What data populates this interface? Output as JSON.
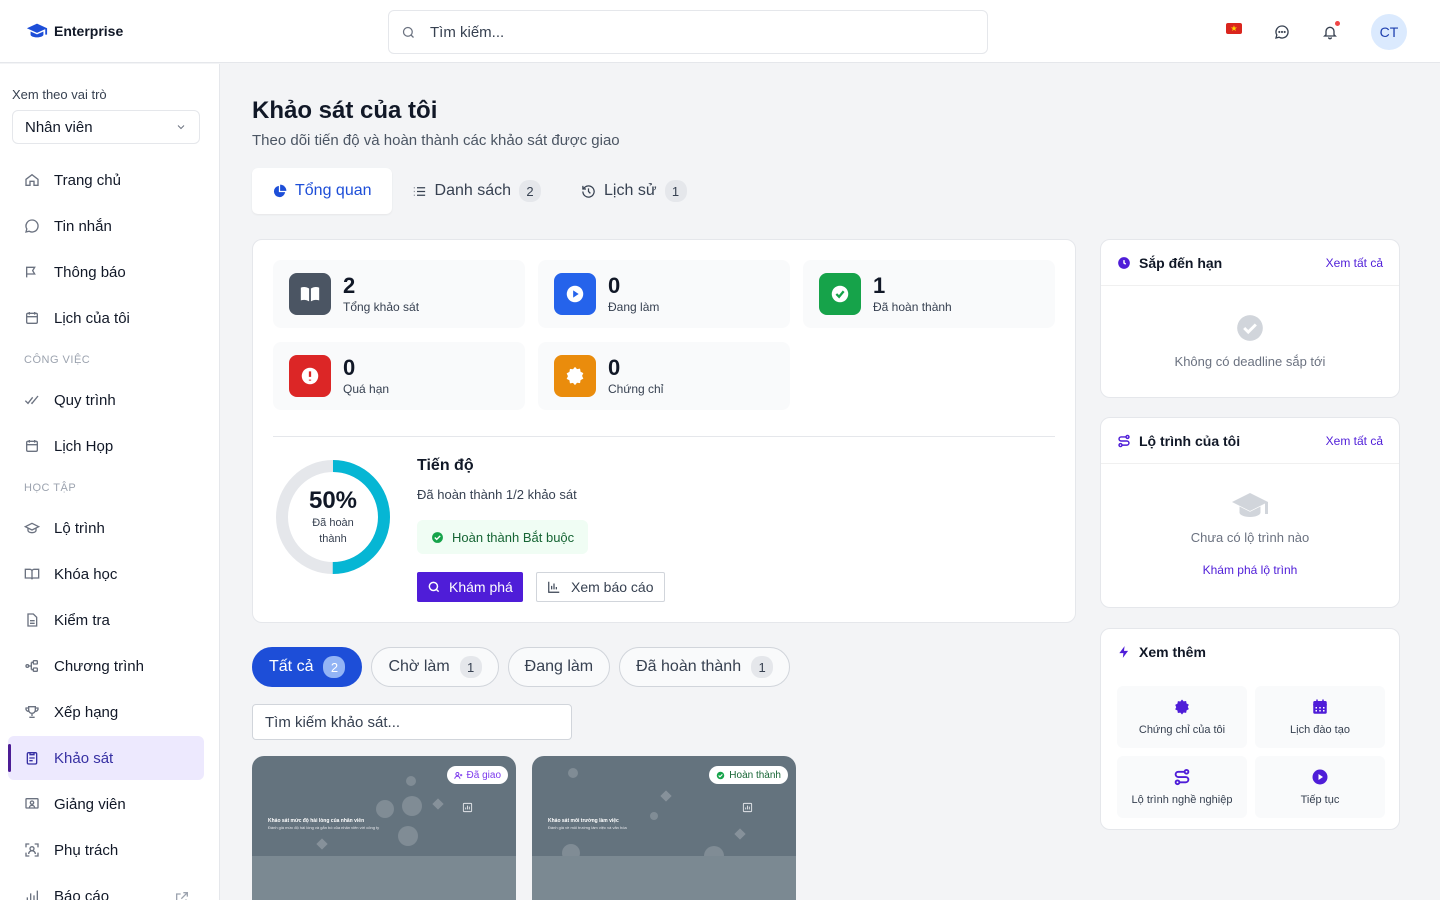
{
  "brand": {
    "name": "Enterprise"
  },
  "search": {
    "placeholder": "Tìm kiếm..."
  },
  "user": {
    "initials": "CT"
  },
  "colors": {
    "primary": "#4f1dd8",
    "active_blue": "#1d4ed8",
    "success": "#16a34a",
    "danger": "#dc2626",
    "warning": "#ea8c0c",
    "info": "#2563eb",
    "progress_ring": "#06b6d4"
  },
  "sidebar": {
    "role_label": "Xem theo vai trò",
    "role_value": "Nhân viên",
    "items": [
      {
        "label": "Trang chủ",
        "icon": "home-icon"
      },
      {
        "label": "Tin nhắn",
        "icon": "chat-icon"
      },
      {
        "label": "Thông báo",
        "icon": "megaphone-icon"
      },
      {
        "label": "Lịch của tôi",
        "icon": "calendar-icon"
      }
    ],
    "section_work": "CÔNG VIỆC",
    "work_items": [
      {
        "label": "Quy trình",
        "icon": "check-double-icon"
      },
      {
        "label": "Lịch Họp",
        "icon": "calendar-icon"
      }
    ],
    "section_learning": "HỌC TẬP",
    "learning_items": [
      {
        "label": "Lộ trình",
        "icon": "graduation-cap-icon"
      },
      {
        "label": "Khóa học",
        "icon": "book-icon"
      },
      {
        "label": "Kiểm tra",
        "icon": "document-icon"
      },
      {
        "label": "Chương trình",
        "icon": "hierarchy-icon"
      },
      {
        "label": "Xếp hạng",
        "icon": "trophy-icon"
      },
      {
        "label": "Khảo sát",
        "icon": "clipboard-icon",
        "active": true
      },
      {
        "label": "Giảng viên",
        "icon": "presenter-icon"
      },
      {
        "label": "Phụ trách",
        "icon": "person-scan-icon"
      },
      {
        "label": "Báo cáo",
        "icon": "bar-chart-icon"
      }
    ]
  },
  "page": {
    "title": "Khảo sát của tôi",
    "subtitle": "Theo dõi tiến độ và hoàn thành các khảo sát được giao"
  },
  "tabs": [
    {
      "label": "Tổng quan",
      "icon": "pie-chart-icon",
      "active": true
    },
    {
      "label": "Danh sách",
      "icon": "list-icon",
      "count": "2"
    },
    {
      "label": "Lịch sử",
      "icon": "history-icon",
      "count": "1"
    }
  ],
  "stats": [
    {
      "value": "2",
      "label": "Tổng khảo sát",
      "icon": "book-open-icon",
      "color": "#4b5563"
    },
    {
      "value": "0",
      "label": "Đang làm",
      "icon": "play-icon",
      "color": "#2563eb"
    },
    {
      "value": "1",
      "label": "Đã hoàn thành",
      "icon": "check-icon",
      "color": "#16a34a"
    },
    {
      "value": "0",
      "label": "Quá hạn",
      "icon": "alert-icon",
      "color": "#dc2626"
    },
    {
      "value": "0",
      "label": "Chứng chỉ",
      "icon": "certificate-icon",
      "color": "#ea8c0c"
    }
  ],
  "progress": {
    "percent_value": 50,
    "percent_text": "50%",
    "ring_label": "Đã hoàn thành",
    "title": "Tiến độ",
    "description": "Đã hoàn thành 1/2 khảo sát",
    "required_badge": "Hoàn thành Bắt buộc",
    "explore_button": "Khám phá",
    "report_button": "Xem báo cáo"
  },
  "filters": [
    {
      "label": "Tất cả",
      "count": "2",
      "active": true
    },
    {
      "label": "Chờ làm",
      "count": "1"
    },
    {
      "label": "Đang làm",
      "count": ""
    },
    {
      "label": "Đã hoàn thành",
      "count": "1"
    }
  ],
  "survey_search": {
    "placeholder": "Tìm kiếm khảo sát..."
  },
  "survey_cards": [
    {
      "badge": "Đã giao",
      "badge_icon": "user-plus-icon",
      "title": "Khảo sát mức độ hài lòng của nhân viên",
      "desc": "Đánh giá mức độ hài lòng và gắn bó của nhân viên với công ty"
    },
    {
      "badge": "Hoàn thành",
      "badge_icon": "check-circle-icon",
      "title": "Khảo sát môi trường làm việc",
      "desc": "Đánh giá về môi trường làm việc và văn hóa"
    }
  ],
  "upcoming": {
    "title": "Sắp đến hạn",
    "link": "Xem tất cả",
    "empty_text": "Không có deadline sắp tới"
  },
  "paths": {
    "title": "Lộ trình của tôi",
    "link": "Xem tất cả",
    "empty_text": "Chưa có lộ trình nào",
    "cta": "Khám phá lộ trình"
  },
  "more": {
    "title": "Xem thêm",
    "items": [
      {
        "label": "Chứng chỉ của tôi",
        "icon": "certificate-icon"
      },
      {
        "label": "Lịch đào tạo",
        "icon": "calendar-grid-icon"
      },
      {
        "label": "Lộ trình nghề nghiệp",
        "icon": "route-icon"
      },
      {
        "label": "Tiếp tục",
        "icon": "play-circle-icon"
      }
    ]
  }
}
